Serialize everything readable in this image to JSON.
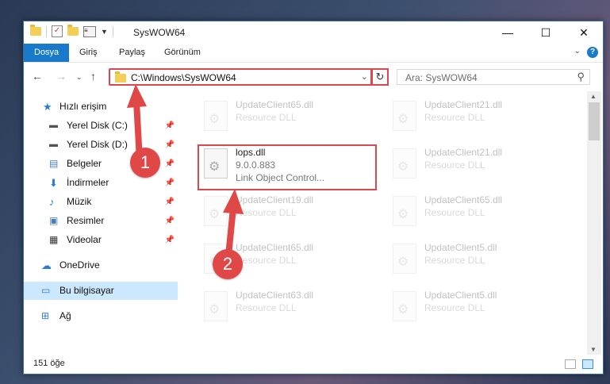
{
  "window": {
    "title": "SysWOW64"
  },
  "ribbon": {
    "tabs": [
      "Dosya",
      "Giriş",
      "Paylaş",
      "Görünüm"
    ]
  },
  "address": {
    "path": "C:\\Windows\\SysWOW64",
    "search_placeholder": "Ara: SysWOW64"
  },
  "sidebar": {
    "items": [
      {
        "label": "Hızlı erişim"
      },
      {
        "label": "Yerel Disk (C:)"
      },
      {
        "label": "Yerel Disk (D:)"
      },
      {
        "label": "Belgeler"
      },
      {
        "label": "İndirmeler"
      },
      {
        "label": "Müzik"
      },
      {
        "label": "Resimler"
      },
      {
        "label": "Videolar"
      },
      {
        "label": "OneDrive"
      },
      {
        "label": "Bu bilgisayar"
      },
      {
        "label": "Ağ"
      }
    ]
  },
  "files": {
    "left": [
      {
        "name": "UpdateClient65.dll",
        "type": "Resource DLL"
      },
      {
        "name": "lops.dll",
        "type": "9.0.0.883",
        "desc": "Link Object Control..."
      },
      {
        "name": "UpdateClient19.dll",
        "type": "Resource DLL"
      },
      {
        "name": "UpdateClient65.dll",
        "type": "Resource DLL"
      },
      {
        "name": "UpdateClient63.dll",
        "type": "Resource DLL"
      }
    ],
    "right": [
      {
        "name": "UpdateClient21.dll",
        "type": "Resource DLL"
      },
      {
        "name": "UpdateClient21.dll",
        "type": "Resource DLL"
      },
      {
        "name": "UpdateClient65.dll",
        "type": "Resource DLL"
      },
      {
        "name": "UpdateClient5.dll",
        "type": "Resource DLL"
      },
      {
        "name": "UpdateClient5.dll",
        "type": "Resource DLL"
      }
    ]
  },
  "status": {
    "count": "151 öğe"
  },
  "annotations": {
    "step1": "1",
    "step2": "2"
  },
  "colors": {
    "accent": "#1979ca",
    "highlight": "#d9474f",
    "selection": "#cce8ff"
  }
}
